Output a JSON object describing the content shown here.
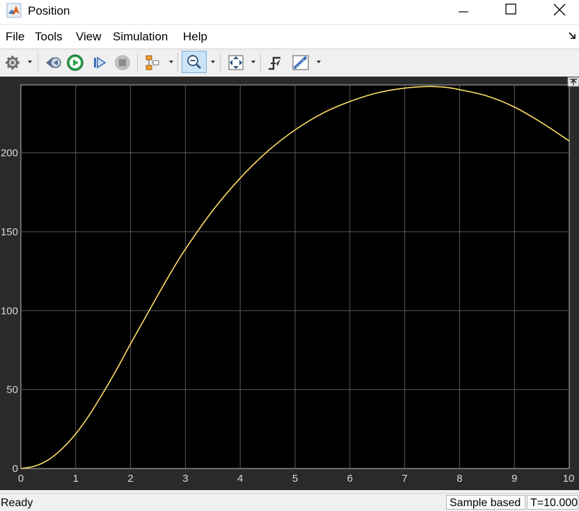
{
  "window": {
    "title": "Position",
    "controls": [
      "minimize-icon",
      "maximize-icon",
      "close-icon"
    ]
  },
  "menu": {
    "items": [
      "File",
      "Tools",
      "View",
      "Simulation",
      "Help"
    ]
  },
  "toolbar": {
    "buttons": [
      "gear-icon",
      "step-back-icon",
      "run-icon",
      "step-forward-icon",
      "stop-icon",
      "signal-selector-icon",
      "zoom-icon",
      "autoscale-icon",
      "triggers-icon",
      "measurements-icon"
    ]
  },
  "status": {
    "ready": "Ready",
    "mode": "Sample based",
    "time": "T=10.000"
  },
  "colors": {
    "trace": "#ffe066",
    "plot_bg": "#000000",
    "frame_bg": "#2a2a2a",
    "grid": "#5a5a5a",
    "tick_text": "#d9d9d9"
  },
  "chart_data": {
    "type": "line",
    "title": "",
    "xlabel": "",
    "ylabel": "",
    "xlim": [
      0,
      10
    ],
    "ylim": [
      0,
      243
    ],
    "xticks": [
      "0",
      "1",
      "2",
      "3",
      "4",
      "5",
      "6",
      "7",
      "8",
      "9",
      "10"
    ],
    "yticks": [
      "0",
      "50",
      "100",
      "150",
      "200"
    ],
    "grid": true,
    "series": [
      {
        "x": [
          0,
          0.25,
          0.5,
          0.75,
          1.0,
          1.25,
          1.5,
          1.75,
          2.0,
          2.25,
          2.5,
          2.75,
          3.0,
          3.5,
          4.0,
          4.5,
          5.0,
          5.5,
          6.0,
          6.5,
          7.0,
          7.4,
          7.75,
          8.0,
          8.5,
          9.0,
          9.5,
          10.0
        ],
        "y": [
          0,
          1.5,
          5.5,
          12.5,
          22,
          34,
          48,
          63,
          79,
          94.5,
          110,
          125,
          139,
          163.5,
          184,
          201,
          214.5,
          225,
          232.5,
          238,
          241,
          242,
          241.5,
          240,
          236,
          229,
          219,
          207.5
        ]
      }
    ]
  }
}
